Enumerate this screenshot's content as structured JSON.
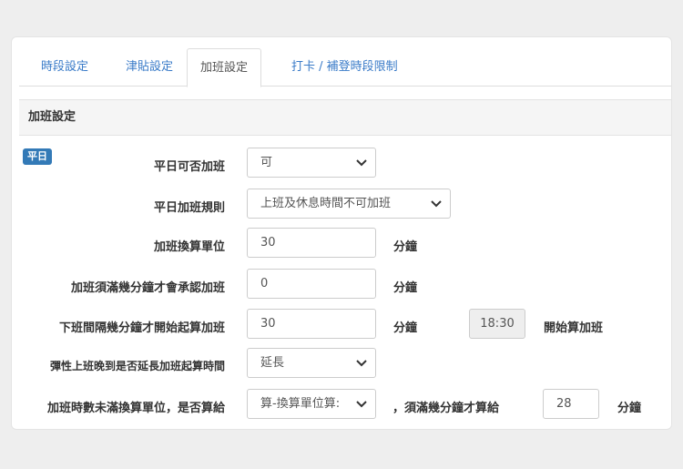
{
  "tabs": [
    {
      "label": "時段設定"
    },
    {
      "label": "津貼設定"
    },
    {
      "label": "加班設定"
    },
    {
      "label": "打卡 / 補登時段限制"
    }
  ],
  "panel": {
    "title": "加班設定"
  },
  "badge": "平日",
  "rows": {
    "allow": {
      "label": "平日可否加班",
      "value": "可"
    },
    "rule": {
      "label": "平日加班規則",
      "value": "上班及休息時間不可加班"
    },
    "unit": {
      "label": "加班換算單位",
      "value": "30",
      "unit": "分鐘"
    },
    "min": {
      "label": "加班須滿幾分鐘才會承認加班",
      "value": "0",
      "unit": "分鐘"
    },
    "gap": {
      "label": "下班間隔幾分鐘才開始起算加班",
      "value": "30",
      "unit": "分鐘",
      "time": "18:30",
      "after": "開始算加班"
    },
    "late": {
      "label": "彈性上班晚到是否延長加班起算時間",
      "value": "延長"
    },
    "remainder": {
      "label": "加班時數未滿換算單位，是否算給",
      "value": "算-換算單位算:",
      "mid": "，須滿幾分鐘才算給",
      "value2": "28",
      "unit": "分鐘"
    }
  }
}
